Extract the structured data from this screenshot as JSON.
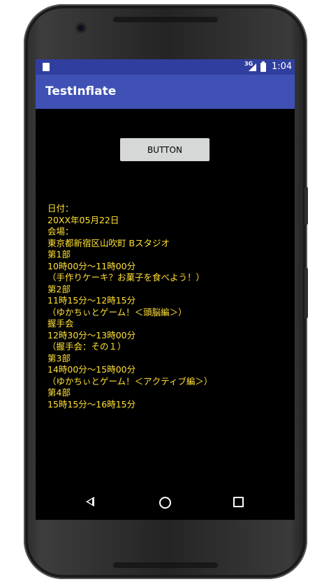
{
  "status_bar": {
    "network": "3G",
    "time": "1:04",
    "icons": [
      "sd-card-icon",
      "signal-icon",
      "battery-icon"
    ]
  },
  "app_bar": {
    "title": "TestInflate"
  },
  "main": {
    "button_label": "BUTTON",
    "schedule_lines": [
      "日付：",
      "20XX年05月22日",
      "会場：",
      "東京都新宿区山吹町 Bスタジオ",
      "第1部",
      "10時00分〜11時00分",
      "（手作りケーキ？お菓子を食べよう！）",
      "第2部",
      "11時15分〜12時15分",
      "（ゆかちぃとゲーム！＜頭脳編＞）",
      "握手会",
      "12時30分〜13時00分",
      "（握手会：その１）",
      "第3部",
      "14時00分〜15時00分",
      "（ゆかちぃとゲーム！＜アクティブ編＞）",
      "第4部",
      "15時15分〜16時15分"
    ]
  },
  "nav_bar": {
    "icons": [
      "back-icon",
      "home-icon",
      "recent-apps-icon"
    ]
  },
  "colors": {
    "status_bar": "#303F9F",
    "app_bar": "#3F51B5",
    "text": "#FFE033",
    "button": "#D6D7D7",
    "screen_bg": "#000000"
  }
}
